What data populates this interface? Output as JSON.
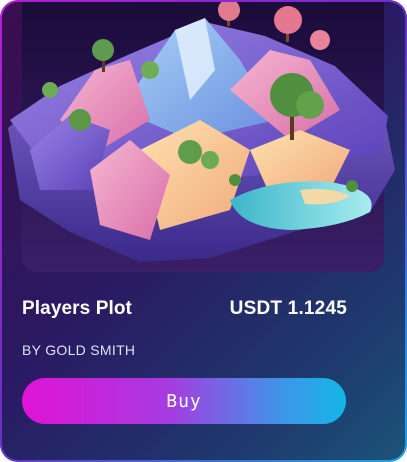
{
  "card": {
    "title": "Players Plot",
    "price": "USDT 1.1245",
    "creator": "BY GOLD SMITH",
    "buy_label": "Buy"
  },
  "image": {
    "subject": "low-poly island terrain with trees"
  },
  "colors": {
    "background_start": "#3b0d4f",
    "background_end": "#1b5578",
    "button_start": "#e013d6",
    "button_end": "#14b6e6",
    "text": "#ffffff"
  }
}
